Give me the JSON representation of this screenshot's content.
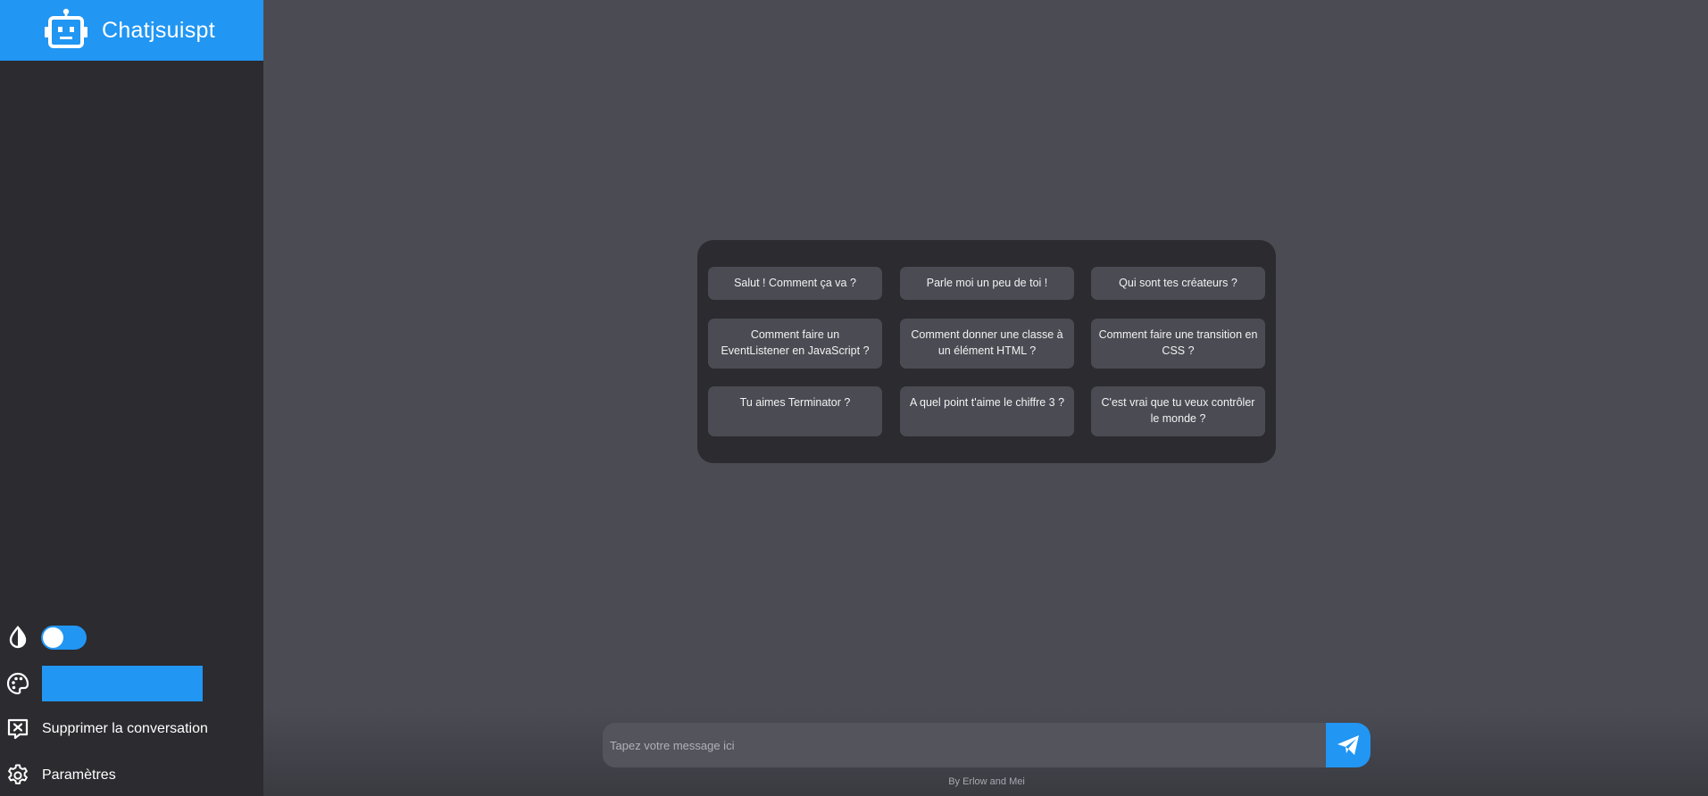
{
  "brand": {
    "title": "Chatjsuispt"
  },
  "sidebar": {
    "delete_label": "Supprimer la conversation",
    "settings_label": "Paramètres"
  },
  "suggestions": [
    "Salut ! Comment ça va ?",
    "Parle moi un peu de toi !",
    "Qui sont tes créateurs ?",
    "Comment faire un EventListener en JavaScript ?",
    "Comment donner une classe à un élément HTML ?",
    "Comment faire une transition en CSS ?",
    "Tu aimes Terminator ?",
    "A quel point t'aime le chiffre 3 ?",
    "C'est vrai que tu veux contrôler le monde ?"
  ],
  "composer": {
    "placeholder": "Tapez votre message ici",
    "value": ""
  },
  "footer": {
    "credit": "By Erlow and Mei"
  },
  "colors": {
    "accent": "#2196f3",
    "sidebar_bg": "#2b2b30",
    "main_bg": "#4b4b54"
  },
  "icons": {
    "logo": "robot-icon",
    "contrast": "contrast-drop-icon",
    "palette": "palette-icon",
    "delete": "chat-x-icon",
    "settings": "gear-icon",
    "send": "paper-plane-icon"
  },
  "theme_toggle": {
    "enabled": true
  }
}
